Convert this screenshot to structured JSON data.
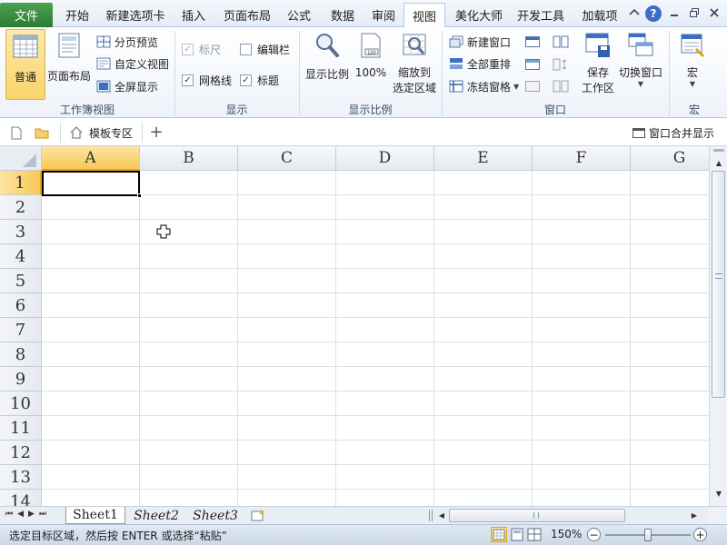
{
  "menu": {
    "file": "文件",
    "tabs": [
      "开始",
      "新建选项卡",
      "插入",
      "页面布局",
      "公式",
      "数据",
      "审阅",
      "视图",
      "美化大师",
      "开发工具",
      "加载项"
    ],
    "active_tab": "视图",
    "help": "?"
  },
  "ribbon": {
    "workbook_view": {
      "label": "工作簿视图",
      "normal": "普通",
      "page_layout": "页面布局",
      "page_break": "分页预览",
      "custom_view": "自定义视图",
      "fullscreen": "全屏显示"
    },
    "show": {
      "label": "显示",
      "ruler": "标尺",
      "ruler_checked": true,
      "ruler_disabled": true,
      "formula_bar": "编辑栏",
      "formula_bar_checked": false,
      "gridlines": "网格线",
      "gridlines_checked": true,
      "headings": "标题",
      "headings_checked": true
    },
    "zoom": {
      "label": "显示比例",
      "zoom": "显示比例",
      "pct100": "100%",
      "zoom_sel_1": "缩放到",
      "zoom_sel_2": "选定区域"
    },
    "window": {
      "label": "窗口",
      "new_window": "新建窗口",
      "arrange_all": "全部重排",
      "freeze_panes": "冻结窗格",
      "save_ws_1": "保存",
      "save_ws_2": "工作区",
      "switch_window": "切换窗口"
    },
    "macro": {
      "label": "宏",
      "macro": "宏"
    }
  },
  "quickbar": {
    "template_zone": "模板专区",
    "add": "+",
    "merge_windows": "窗口合并显示"
  },
  "grid": {
    "columns": [
      "A",
      "B",
      "C",
      "D",
      "E",
      "F",
      "G"
    ],
    "rows": [
      "1",
      "2",
      "3",
      "4",
      "5",
      "6",
      "7",
      "8",
      "9",
      "10",
      "11",
      "12",
      "13",
      "14"
    ],
    "selected_cell": "A1"
  },
  "sheets": {
    "tabs": [
      "Sheet1",
      "Sheet2",
      "Sheet3"
    ],
    "active": "Sheet1"
  },
  "status": {
    "message": "选定目标区域，然后按 ENTER 或选择“粘贴”",
    "zoom": "150%",
    "zoom_level": 0.5
  }
}
